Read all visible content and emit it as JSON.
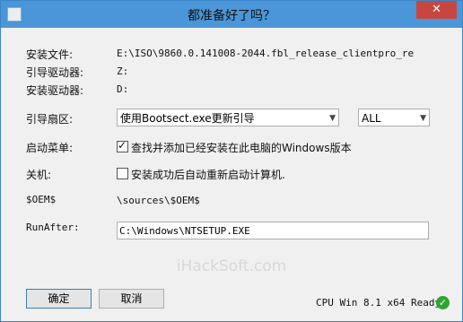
{
  "window": {
    "title": "都准备好了吗？",
    "close_glyph": "✕"
  },
  "fields": {
    "install_file": {
      "label": "安装文件:",
      "value": "E:\\ISO\\9860.0.141008-2044.fbl_release_clientpro_re"
    },
    "boot_drive": {
      "label": "引导驱动器:",
      "value": "Z:"
    },
    "install_drive": {
      "label": "安装驱动器:",
      "value": "D:"
    },
    "boot_sector": {
      "label": "引导扇区:",
      "selected": "使用Bootsect.exe更新引导",
      "mode_selected": "ALL"
    },
    "boot_menu": {
      "label": "启动菜单:",
      "checkbox_label": "查找并添加已经安装在此电脑的Windows版本",
      "checked": true
    },
    "shutdown": {
      "label": "关机:",
      "checkbox_label": "安装成功后自动重新启动计算机.",
      "checked": false
    },
    "oem": {
      "label": "$OEM$",
      "value": "\\sources\\$OEM$"
    },
    "runafter": {
      "label": "RunAfter:",
      "value": "C:\\Windows\\NTSETUP.EXE"
    }
  },
  "watermark": "iHackSoft.com",
  "buttons": {
    "ok": "确定",
    "cancel": "取消"
  },
  "status": {
    "text": "CPU Win 8.1 x64 Ready",
    "icon": "check-circle-icon",
    "color": "#2fa52f"
  }
}
